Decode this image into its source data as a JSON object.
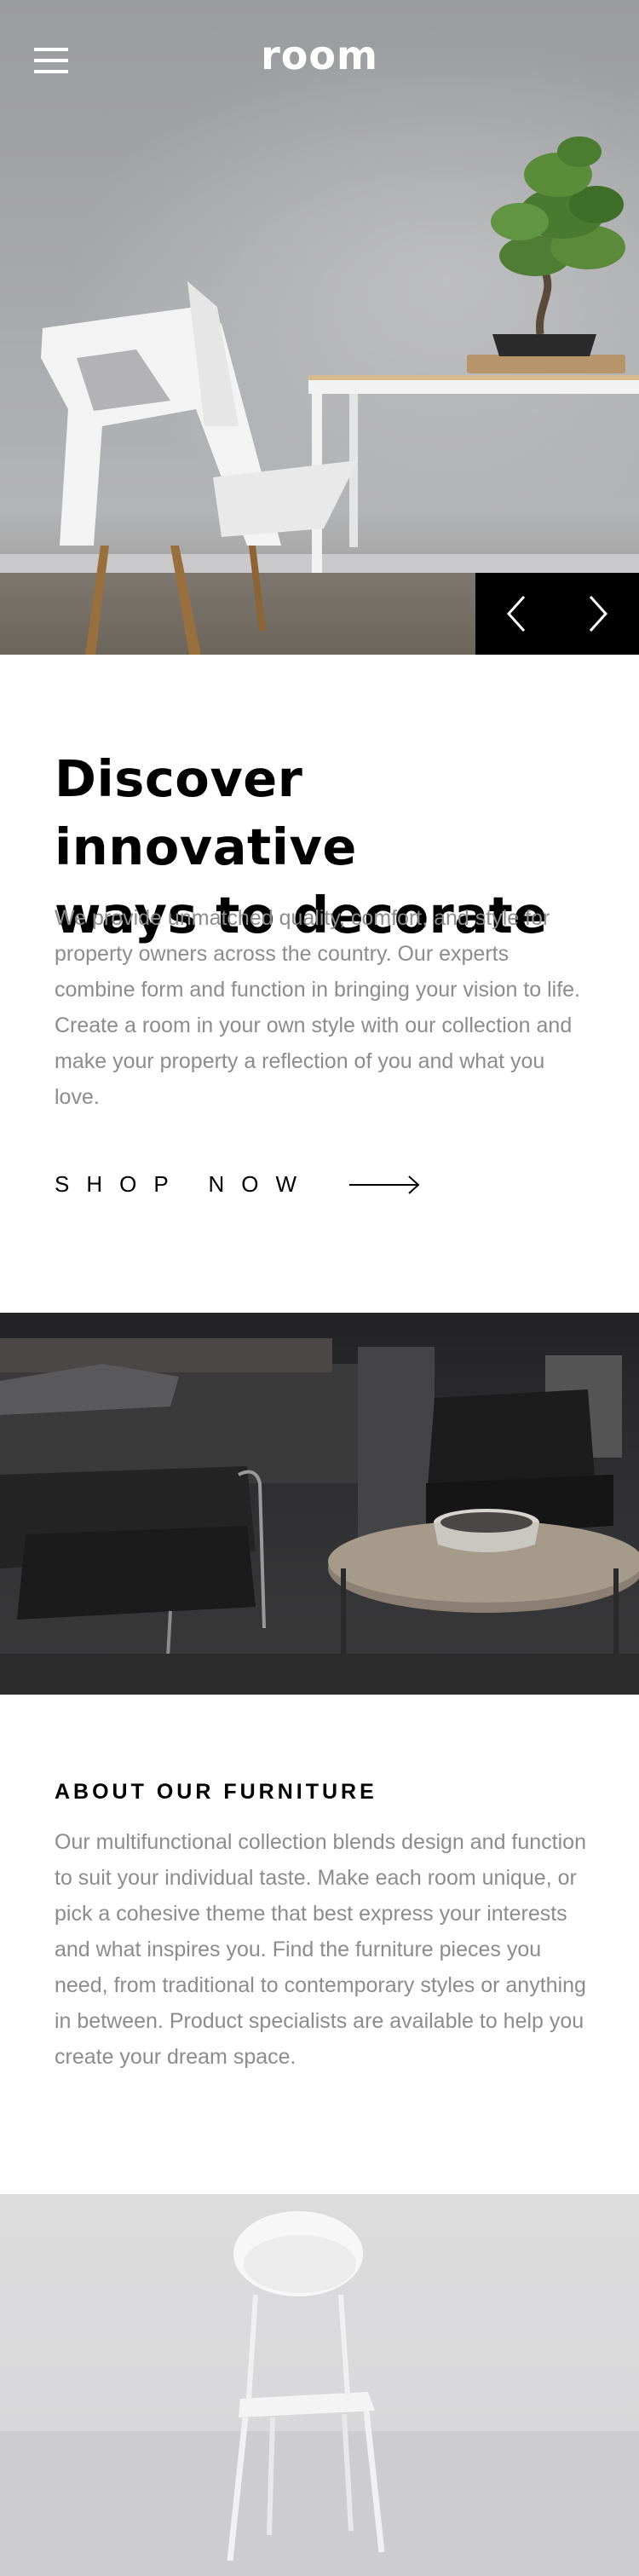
{
  "header": {
    "logo": "room",
    "menu_icon": "hamburger-menu-icon"
  },
  "hero": {
    "image": "white-chair-table-bonsai-photo",
    "prev_icon": "chevron-left-icon",
    "next_icon": "chevron-right-icon"
  },
  "intro": {
    "title_line1": "Discover innovative",
    "title_line2": "ways to decorate",
    "body": "We provide unmatched quality, comfort, and style for property owners across the country. Our experts combine form and function in bringing your vision to life. Create a room in your own style with our collection and make your property a reflection of you and what you love.",
    "cta_label": "SHOP NOW",
    "cta_icon": "arrow-right-icon"
  },
  "dark_image": {
    "image": "dark-armchair-coffee-table-photo"
  },
  "about": {
    "heading": "ABOUT OUR FURNITURE",
    "body": "Our multifunctional collection blends design and function to suit your individual taste. Make each room unique, or pick a cohesive theme that best express your interests and what inspires you. Find the furniture pieces you need, from traditional to contemporary styles or anything in between. Product specialists are available to help you create your dream space."
  },
  "light_image": {
    "image": "white-chair-light-room-photo"
  },
  "colors": {
    "text": "#000000",
    "muted_text": "#8c8c8c",
    "control_bg": "#000000",
    "background": "#ffffff"
  }
}
